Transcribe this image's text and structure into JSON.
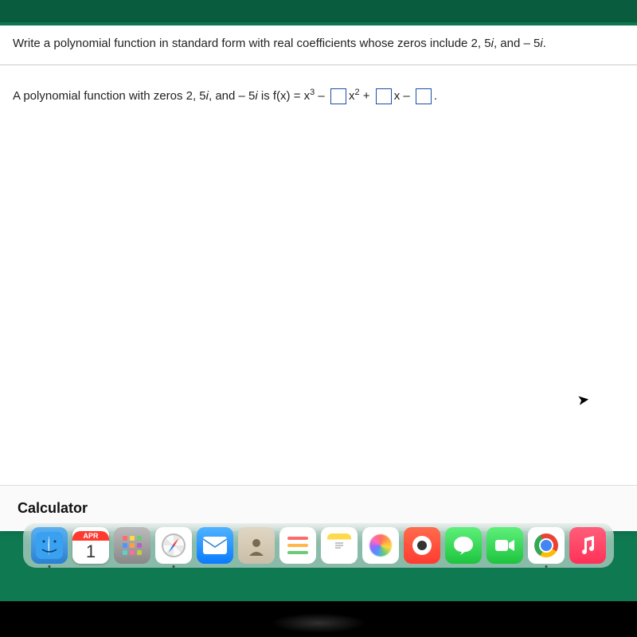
{
  "question": {
    "prefix": "Write a polynomial function in standard form with real coefficients whose zeros include 2, 5",
    "i1": "i",
    "mid": ", and  – 5",
    "i2": "i",
    "suffix": "."
  },
  "answer": {
    "prefix": "A polynomial function with zeros 2, 5",
    "i1": "i",
    "mid": ", and  – 5",
    "i2": "i",
    "eq": " is f(x) = x",
    "sup3": "3",
    "minus1": " – ",
    "xsup2": "x",
    "sup2": "2",
    "plus": " + ",
    "xminus": "x – ",
    "period": "."
  },
  "calculator_label": "Calculator",
  "calendar": {
    "month": "APR",
    "day": "1"
  }
}
